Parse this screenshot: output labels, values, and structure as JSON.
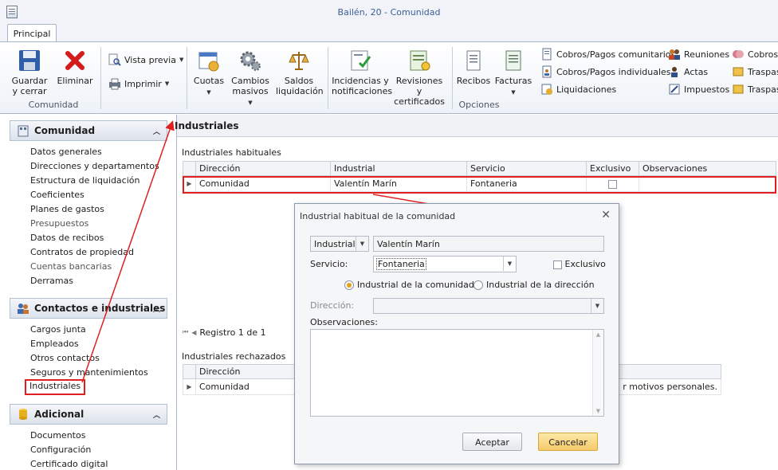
{
  "window": {
    "title": "Bailén, 20 - Comunidad"
  },
  "tabs": [
    {
      "label": "Principal"
    }
  ],
  "ribbon": {
    "guardar": "Guardar\ny cerrar",
    "eliminar": "Eliminar",
    "vista_previa": "Vista previa",
    "imprimir": "Imprimir",
    "cuotas": "Cuotas",
    "cambios_masivos": "Cambios\nmasivos",
    "saldos_liquidacion": "Saldos\nliquidación",
    "incidencias": "Incidencias y\nnotificaciones",
    "revisiones": "Revisiones y\ncertificados",
    "recibos": "Recibos",
    "facturas": "Facturas",
    "cobros_comunitarios": "Cobros/Pagos comunitarios",
    "cobros_individuales": "Cobros/Pagos individuales",
    "liquidaciones": "Liquidaciones",
    "reuniones": "Reuniones",
    "actas": "Actas",
    "impuestos": "Impuestos",
    "cobros_cut": "Cobros",
    "traspas_1": "Traspas",
    "traspas_2": "Traspas",
    "group_comunidad": "Comunidad",
    "group_opciones": "Opciones"
  },
  "sidebar": {
    "sections": [
      {
        "title": "Comunidad"
      },
      {
        "title": "Contactos e industriales"
      },
      {
        "title": "Adicional"
      }
    ],
    "comunidad_items": [
      "Datos generales",
      "Direcciones y departamentos",
      "Estructura de liquidación",
      "Coeficientes",
      "Planes de gastos",
      "Presupuestos",
      "Datos de recibos",
      "Contratos de propiedad",
      "Cuentas bancarias",
      "Derramas"
    ],
    "contactos_items": [
      "Cargos junta",
      "Empleados",
      "Otros contactos",
      "Seguros y mantenimientos",
      "Industriales"
    ],
    "adicional_items": [
      "Documentos",
      "Configuración",
      "Certificado digital"
    ]
  },
  "main": {
    "title": "Industriales",
    "habituales_label": "Industriales habituales",
    "columns": [
      "Dirección",
      "Industrial",
      "Servicio",
      "Exclusivo",
      "Observaciones"
    ],
    "habituales_rows": [
      {
        "direccion": "Comunidad",
        "industrial": "Valentín Marín",
        "servicio": "Fontaneria",
        "exclusivo": false,
        "observaciones": ""
      }
    ],
    "pager": "Registro 1 de 1",
    "rechazados_label": "Industriales rechazados",
    "rechazados_columns": [
      "Dirección"
    ],
    "rechazados_rows": [
      {
        "direccion": "Comunidad",
        "observaciones_tail": "r motivos personales."
      }
    ]
  },
  "dialog": {
    "title": "Industrial habitual de la comunidad",
    "type_value": "Industrial",
    "name_value": "Valentín Marín",
    "servicio_label": "Servicio:",
    "servicio_value": "Fontaneria",
    "exclusivo_label": "Exclusivo",
    "radio_comunidad": "Industrial de la comunidad",
    "radio_direccion": "Industrial de la dirección",
    "direccion_label": "Dirección:",
    "observaciones_label": "Observaciones:",
    "accept": "Aceptar",
    "cancel": "Cancelar"
  },
  "colors": {
    "accent": "#3b5f97",
    "highlight_red": "#e02020",
    "primary_button": "#f7c96a"
  }
}
